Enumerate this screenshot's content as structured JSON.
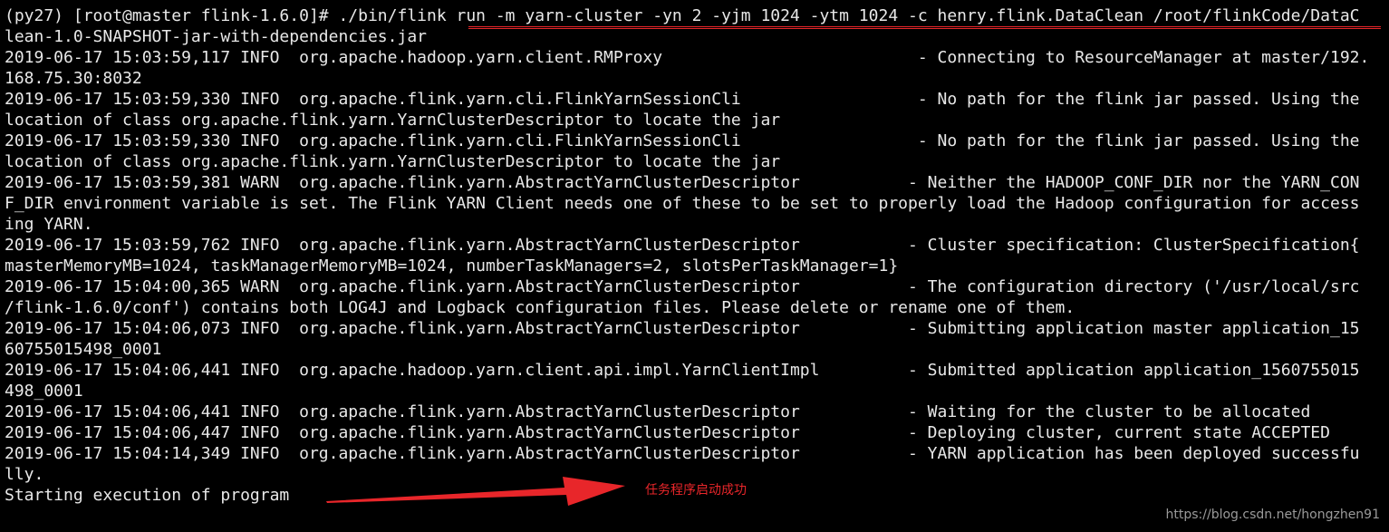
{
  "terminal": {
    "lines": [
      "(py27) [root@master flink-1.6.0]# ./bin/flink run -m yarn-cluster -yn 2 -yjm 1024 -ytm 1024 -c henry.flink.DataClean /root/flinkCode/DataC",
      "lean-1.0-SNAPSHOT-jar-with-dependencies.jar",
      "2019-06-17 15:03:59,117 INFO  org.apache.hadoop.yarn.client.RMProxy                          - Connecting to ResourceManager at master/192.",
      "168.75.30:8032",
      "2019-06-17 15:03:59,330 INFO  org.apache.flink.yarn.cli.FlinkYarnSessionCli                  - No path for the flink jar passed. Using the",
      "location of class org.apache.flink.yarn.YarnClusterDescriptor to locate the jar",
      "2019-06-17 15:03:59,330 INFO  org.apache.flink.yarn.cli.FlinkYarnSessionCli                  - No path for the flink jar passed. Using the",
      "location of class org.apache.flink.yarn.YarnClusterDescriptor to locate the jar",
      "2019-06-17 15:03:59,381 WARN  org.apache.flink.yarn.AbstractYarnClusterDescriptor           - Neither the HADOOP_CONF_DIR nor the YARN_CON",
      "F_DIR environment variable is set. The Flink YARN Client needs one of these to be set to properly load the Hadoop configuration for access",
      "ing YARN.",
      "2019-06-17 15:03:59,762 INFO  org.apache.flink.yarn.AbstractYarnClusterDescriptor           - Cluster specification: ClusterSpecification{",
      "masterMemoryMB=1024, taskManagerMemoryMB=1024, numberTaskManagers=2, slotsPerTaskManager=1}",
      "2019-06-17 15:04:00,365 WARN  org.apache.flink.yarn.AbstractYarnClusterDescriptor           - The configuration directory ('/usr/local/src",
      "/flink-1.6.0/conf') contains both LOG4J and Logback configuration files. Please delete or rename one of them.",
      "2019-06-17 15:04:06,073 INFO  org.apache.flink.yarn.AbstractYarnClusterDescriptor           - Submitting application master application_15",
      "60755015498_0001",
      "2019-06-17 15:04:06,441 INFO  org.apache.hadoop.yarn.client.api.impl.YarnClientImpl         - Submitted application application_1560755015",
      "498_0001",
      "2019-06-17 15:04:06,441 INFO  org.apache.flink.yarn.AbstractYarnClusterDescriptor           - Waiting for the cluster to be allocated",
      "2019-06-17 15:04:06,447 INFO  org.apache.flink.yarn.AbstractYarnClusterDescriptor           - Deploying cluster, current state ACCEPTED",
      "2019-06-17 15:04:14,349 INFO  org.apache.flink.yarn.AbstractYarnClusterDescriptor           - YARN application has been deployed successfu",
      "lly.",
      "Starting execution of program"
    ]
  },
  "annotation": {
    "text": "任务程序启动成功"
  },
  "watermark": {
    "text": "https://blog.csdn.net/hongzhen91"
  },
  "colors": {
    "background": "#000000",
    "text": "#e8e8e8",
    "annotation_red": "#e8262a",
    "watermark": "#9a9a9a"
  },
  "icons": {
    "arrow": "red-arrow-pointing-left"
  }
}
